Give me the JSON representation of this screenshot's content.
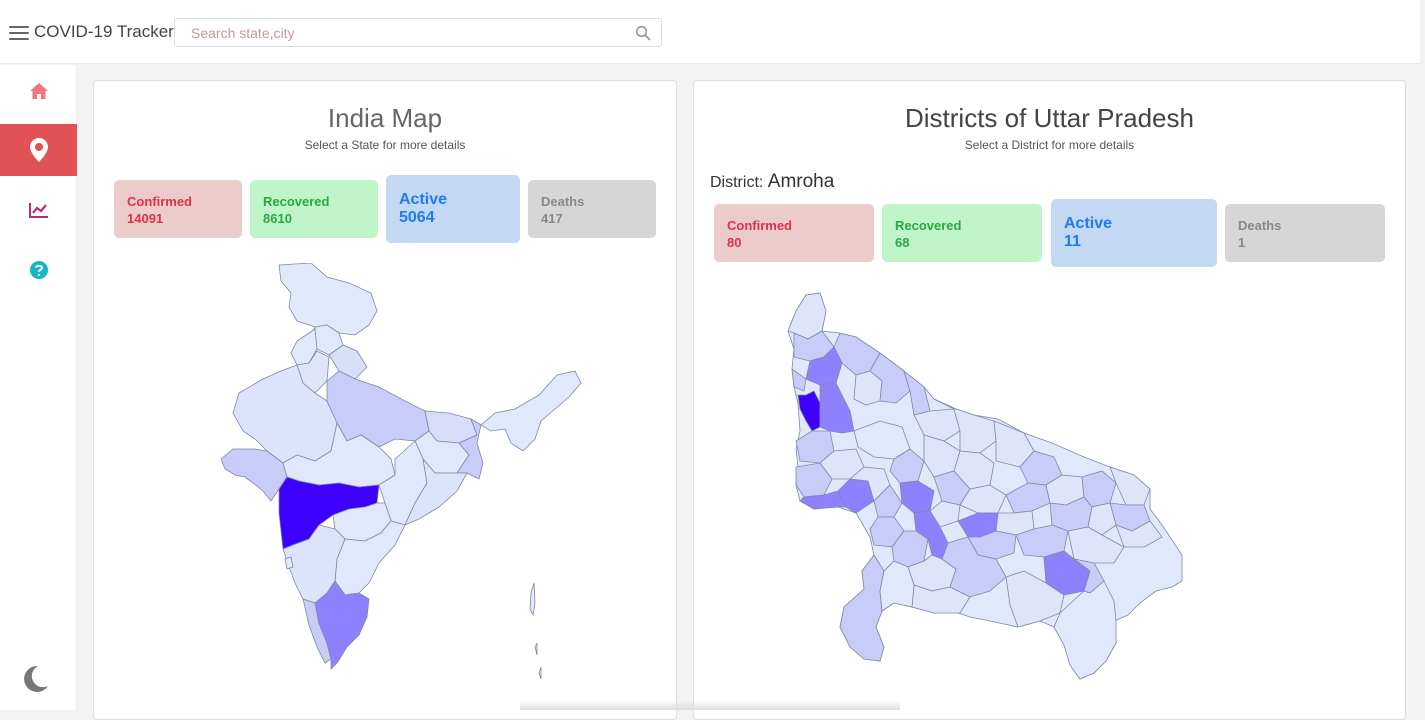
{
  "app": {
    "title": "COVID-19 Tracker"
  },
  "search": {
    "placeholder": "Search state,city",
    "value": ""
  },
  "sidebar": {
    "items": [
      {
        "icon": "home-icon",
        "color": "#f0767a"
      },
      {
        "icon": "map-marker-icon",
        "color": "#ffffff",
        "active": true
      },
      {
        "icon": "chart-line-icon",
        "color": "#b0317a"
      },
      {
        "icon": "help-icon",
        "color": "#17b6c4"
      }
    ],
    "theme_icon": "moon-icon"
  },
  "india_panel": {
    "title": "India Map",
    "subtitle": "Select a State for more details",
    "stats": {
      "confirmed_label": "Confirmed",
      "confirmed": "14091",
      "recovered_label": "Recovered",
      "recovered": "8610",
      "active_label": "Active",
      "active": "5064",
      "deaths_label": "Deaths",
      "deaths": "417"
    },
    "highlight": {
      "state": "Maharashtra",
      "color": "#3d00ff"
    }
  },
  "state_panel": {
    "title": "Districts of Uttar Pradesh",
    "subtitle": "Select a District for more details",
    "district_prefix": "District:",
    "district_name": "Amroha",
    "stats": {
      "confirmed_label": "Confirmed",
      "confirmed": "80",
      "recovered_label": "Recovered",
      "recovered": "68",
      "active_label": "Active",
      "active": "11",
      "deaths_label": "Deaths",
      "deaths": "1"
    }
  },
  "colors": {
    "confirmed_bg": "#eccbcb",
    "recovered_bg": "#bff5c9",
    "active_bg": "#c2d8f3",
    "deaths_bg": "#d6d6d6",
    "map_low": "#e2e8fb",
    "map_mid": "#c9cbf9",
    "map_high": "#8e80ff",
    "map_max": "#3d00ff"
  }
}
